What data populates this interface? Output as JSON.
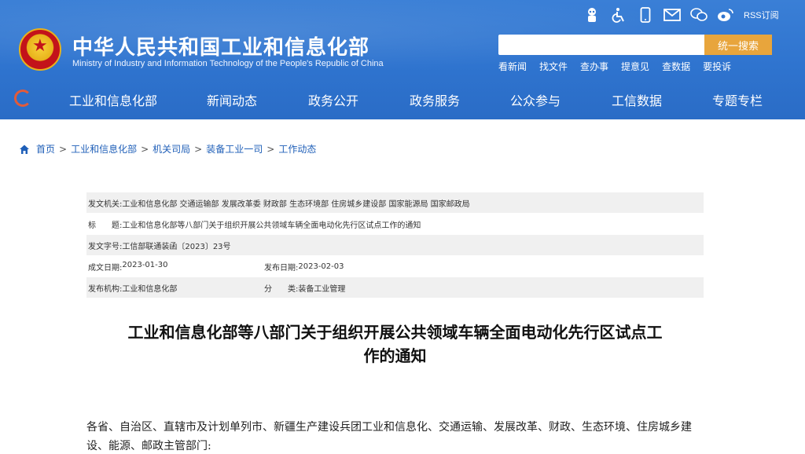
{
  "header": {
    "site_title": "中华人民共和国工业和信息化部",
    "site_subtitle": "Ministry of Industry and Information Technology of the People's Republic of China",
    "top_icons": [
      "robot-icon",
      "accessibility-icon",
      "mobile-icon",
      "mail-icon",
      "wechat-icon",
      "weibo-icon"
    ],
    "rss_label": "RSS订阅",
    "search": {
      "placeholder": "",
      "button_label": "统一搜索"
    },
    "quick_links": [
      "看新闻",
      "找文件",
      "查办事",
      "提意见",
      "查数据",
      "要投诉"
    ]
  },
  "nav": {
    "items": [
      "工业和信息化部",
      "新闻动态",
      "政务公开",
      "政务服务",
      "公众参与",
      "工信数据",
      "专题专栏"
    ]
  },
  "breadcrumb": [
    "首页",
    "工业和信息化部",
    "机关司局",
    "装备工业一司",
    "工作动态"
  ],
  "meta": {
    "issuer_label": "发文机关:",
    "issuer_value": "工业和信息化部 交通运输部 发展改革委 财政部 生态环境部 住房城乡建设部 国家能源局 国家邮政局",
    "title_label": "标　　题:",
    "title_value": "工业和信息化部等八部门关于组织开展公共领域车辆全面电动化先行区试点工作的通知",
    "docno_label": "发文字号:",
    "docno_value": "工信部联通装函〔2023〕23号",
    "created_label": "成文日期:",
    "created_value": "2023-01-30",
    "published_label": "发布日期:",
    "published_value": "2023-02-03",
    "org_label": "发布机构:",
    "org_value": "工业和信息化部",
    "category_label": "分　　类:",
    "category_value": "装备工业管理"
  },
  "document": {
    "title_line1": "工业和信息化部等八部门关于组织开展公共领域车辆全面电动化先行区试点工",
    "title_line2": "作的通知",
    "body_line1": "各省、自治区、直辖市及计划单列市、新疆生产建设兵团工业和信息化、交通运输、发展改革、财政、生态环境、住房城乡建",
    "body_line2": "设、能源、邮政主管部门:"
  }
}
